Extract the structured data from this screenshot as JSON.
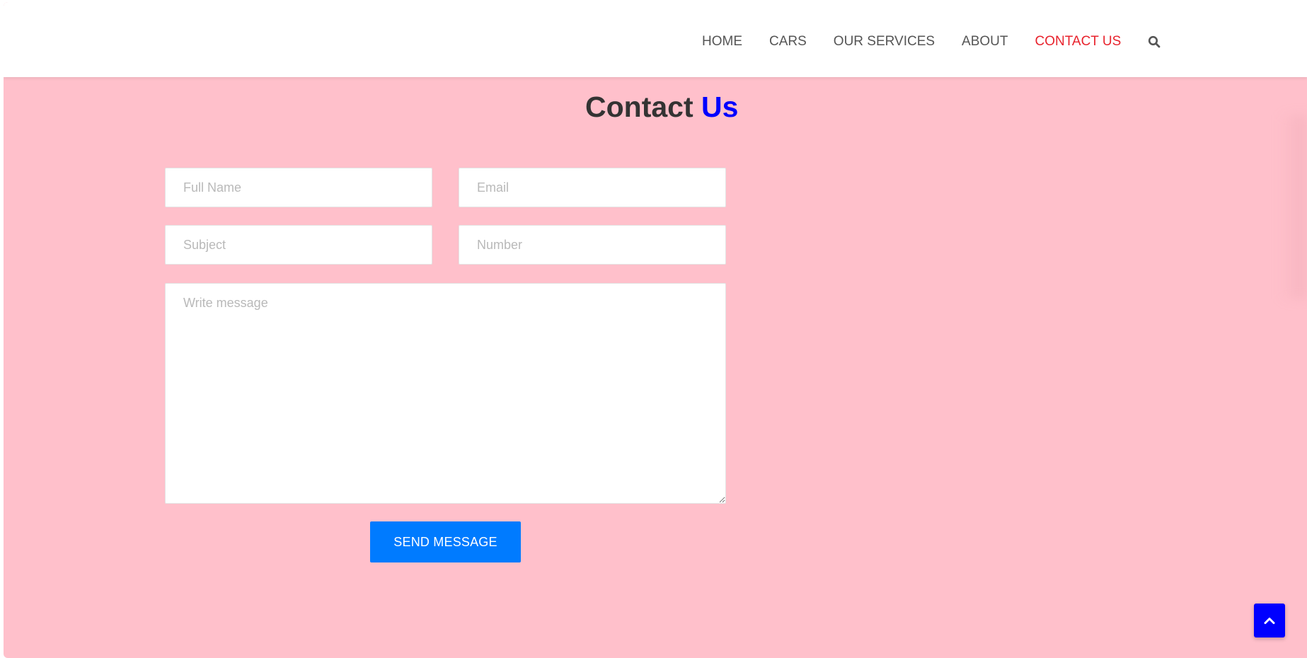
{
  "nav": {
    "items": [
      {
        "label": "HOME",
        "active": false
      },
      {
        "label": "CARS",
        "active": false
      },
      {
        "label": "OUR SERVICES",
        "active": false
      },
      {
        "label": "ABOUT",
        "active": false
      },
      {
        "label": "CONTACT US",
        "active": true
      }
    ],
    "search_icon": "search-icon"
  },
  "heading": {
    "main": "Contact ",
    "accent": "Us"
  },
  "form": {
    "full_name": {
      "placeholder": "Full Name",
      "value": ""
    },
    "email": {
      "placeholder": "Email",
      "value": ""
    },
    "subject": {
      "placeholder": "Subject",
      "value": ""
    },
    "number": {
      "placeholder": "Number",
      "value": ""
    },
    "message": {
      "placeholder": "Write message",
      "value": ""
    },
    "submit_label": "SEND MESSAGE"
  },
  "scroll_top": {
    "icon": "chevron-up-icon"
  },
  "colors": {
    "page_background": "#ffc0cb",
    "nav_active": "#e8232d",
    "heading_accent": "#0000ff",
    "button_primary": "#007bff",
    "scroll_top_background": "#0000ff"
  }
}
